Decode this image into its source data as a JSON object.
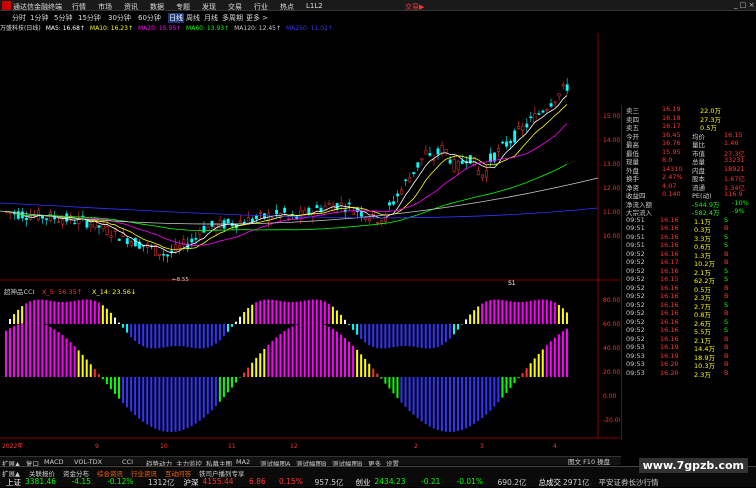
{
  "app": {
    "title": "通达信金融终端",
    "menu": [
      "行情",
      "市场",
      "资讯",
      "数据",
      "专题",
      "发现",
      "交易",
      "行业",
      "热点",
      "L1L2"
    ],
    "trade": "交易▶",
    "win": "_ □ ×"
  },
  "periods": [
    "分时",
    "1分钟",
    "5分钟",
    "15分钟",
    "30分钟",
    "60分钟",
    "日线",
    "周线",
    "月线",
    "多周期",
    "更多 >"
  ],
  "active_period": "日线",
  "ma": [
    {
      "t": "万盛科技(日线)",
      "c": "#ddd"
    },
    {
      "t": "MA5: 16.68↑",
      "c": "#fff"
    },
    {
      "t": "MA10: 16.23↑",
      "c": "#ff0"
    },
    {
      "t": "MA20: 15.95↑",
      "c": "#f0f"
    },
    {
      "t": "MA60: 13.93↑",
      "c": "#0f0"
    },
    {
      "t": "MA120: 12.45↑",
      "c": "#ccc"
    },
    {
      "t": "MA250: 11.02↑",
      "c": "#33f"
    }
  ],
  "chart_data": {
    "type": "candlestick",
    "price_ticks": [
      "15.00",
      "14.00",
      "13.00",
      "12.00",
      "11.00",
      "10.00"
    ],
    "low_label": "8.55",
    "ind_ticks": [
      "80.00",
      "60.00",
      "40.00",
      "20.00",
      "0.00",
      "-20.00"
    ],
    "indicator": {
      "name": "超神品CCI",
      "x5": "X_5: 56.35↑",
      "x14": "X_14: 23.56↓"
    },
    "x_labels": [
      "2022年",
      "9",
      "10",
      "11",
      "12",
      "2",
      "3",
      "4"
    ],
    "marker": "S1"
  },
  "quote": {
    "asks": [
      [
        "卖三",
        "16.19",
        "22.0万"
      ],
      [
        "卖四",
        "16.18",
        "27.3万"
      ],
      [
        "卖五",
        "16.17",
        "0.5万"
      ]
    ],
    "stats": [
      [
        "今开",
        "16.45",
        "均价",
        "16.15"
      ],
      [
        "最高",
        "16.76",
        "量比",
        "1.46"
      ],
      [
        "最低",
        "15.95",
        "市值",
        "27.3亿"
      ],
      [
        "现量",
        "8.0",
        "总量",
        "33231"
      ],
      [
        "外盘",
        "14310",
        "内盘",
        "18921"
      ],
      [
        "换手",
        "2.47%",
        "股本",
        "1.67亿"
      ],
      [
        "净资",
        "4.07",
        "流通",
        "1.34亿"
      ],
      [
        "收益四",
        "0.140",
        "PE(动)",
        "116.9"
      ]
    ],
    "flows": [
      [
        "净流入额",
        "-544.9万",
        "-10%"
      ],
      [
        "大宗流入",
        "-582.4万",
        "-9%"
      ]
    ],
    "trades": [
      [
        "09:51",
        "16.16",
        "1.1万",
        "S"
      ],
      [
        "09:51",
        "16.16",
        "0.3万",
        "B"
      ],
      [
        "09:51",
        "16.16",
        "3.3万",
        "S"
      ],
      [
        "09:51",
        "16.16",
        "0.6万",
        "S"
      ],
      [
        "09:52",
        "16.16",
        "1.3万",
        "B"
      ],
      [
        "09:52",
        "16.17",
        "10.2万",
        "B"
      ],
      [
        "09:52",
        "16.16",
        "2.1万",
        "S"
      ],
      [
        "09:52",
        "16.15",
        "62.2万",
        "S"
      ],
      [
        "09:52",
        "16.16",
        "0.5万",
        "B"
      ],
      [
        "09:52",
        "16.16",
        "2.3万",
        "B"
      ],
      [
        "09:52",
        "16.16",
        "2.7万",
        "S"
      ],
      [
        "09:52",
        "16.16",
        "0.8万",
        "B"
      ],
      [
        "09:52",
        "16.16",
        "2.6万",
        "S"
      ],
      [
        "09:52",
        "16.16",
        "5.5万",
        "S"
      ],
      [
        "09:52",
        "16.16",
        "2.1万",
        "B"
      ],
      [
        "09:53",
        "16.19",
        "14.4万",
        "B"
      ],
      [
        "09:53",
        "16.19",
        "18.9万",
        "B"
      ],
      [
        "09:53",
        "16.20",
        "10.3万",
        "B"
      ],
      [
        "09:53",
        "16.20",
        "2.3万",
        "B"
      ]
    ]
  },
  "tabs": [
    "扩展▲",
    "复口",
    "MACD",
    "VOL-TDX",
    "CCI",
    "趋势动力",
    "主力监控",
    "私募主图",
    "MA2",
    "测试幅图A",
    "测试幅图B",
    "测试幅图B",
    "更多",
    "设置"
  ],
  "tabbar2": [
    "扩展▲",
    "关联报价",
    "资金分布",
    "综合资讯",
    "行业资讯",
    "互动问答",
    "铁司户播列专享"
  ],
  "right_tab": "图文 F10 操盘",
  "bottom": [
    {
      "t": "上证",
      "c": "#fff"
    },
    {
      "t": "3381.46",
      "c": "#0f0"
    },
    {
      "t": "-4.15",
      "c": "#0f0"
    },
    {
      "t": "-0.12%",
      "c": "#0f0"
    },
    {
      "t": "1312亿",
      "c": "#ccc"
    },
    {
      "t": "沪深",
      "c": "#fff"
    },
    {
      "t": "4155.44",
      "c": "#f33"
    },
    {
      "t": "6.86",
      "c": "#f33"
    },
    {
      "t": "0.15%",
      "c": "#f33"
    },
    {
      "t": "957.5亿",
      "c": "#ccc"
    },
    {
      "t": "创业",
      "c": "#fff"
    },
    {
      "t": "2434.23",
      "c": "#0f0"
    },
    {
      "t": "-0.21",
      "c": "#0f0"
    },
    {
      "t": "-0.01%",
      "c": "#0f0"
    },
    {
      "t": "690.2亿",
      "c": "#ccc"
    },
    {
      "t": "总成交",
      "c": "#fff"
    },
    {
      "t": "2971亿",
      "c": "#ccc"
    },
    {
      "t": "平安证券长沙行情",
      "c": "#ccc"
    }
  ],
  "watermark": "www.7gpzb.com"
}
